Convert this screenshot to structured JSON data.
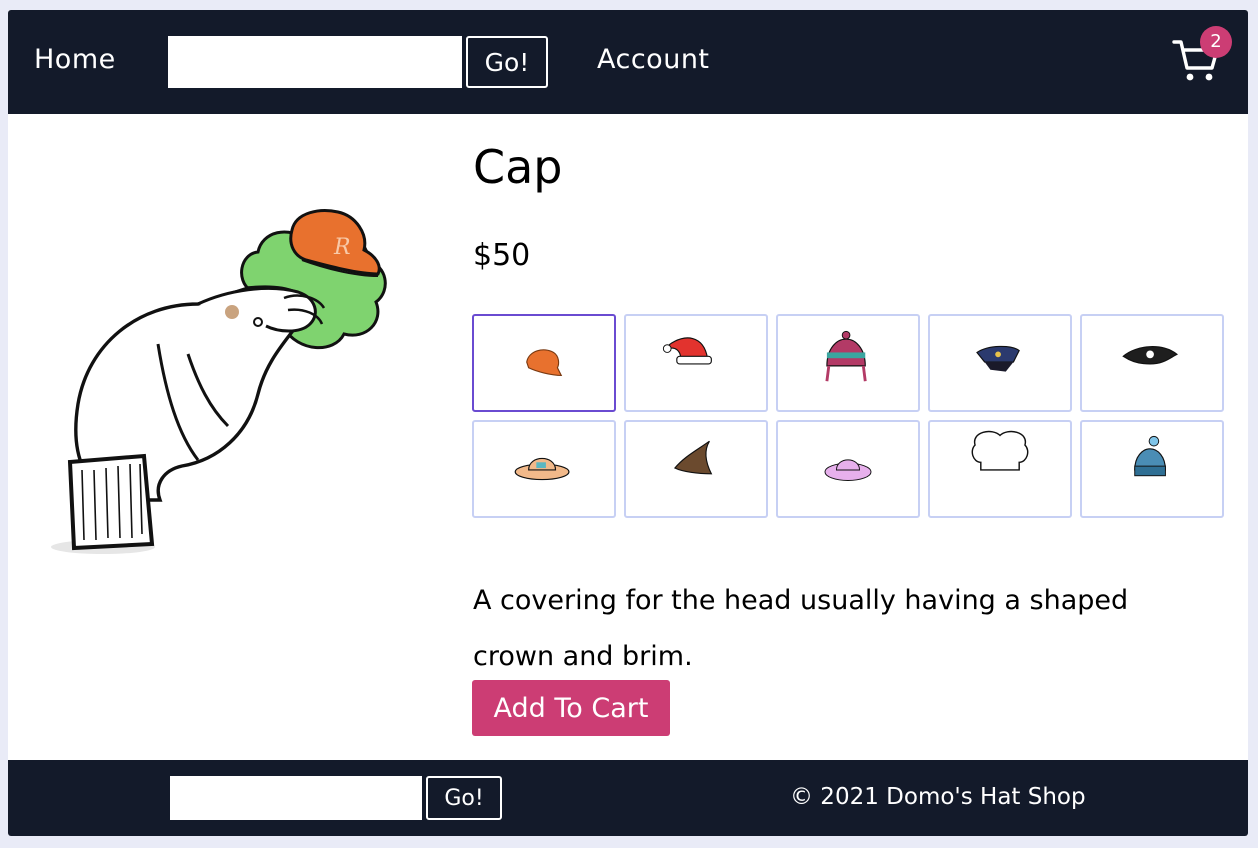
{
  "nav": {
    "home_label": "Home",
    "search_value": "",
    "go_label": "Go!",
    "account_label": "Account",
    "cart_count": "2"
  },
  "product": {
    "title": "Cap",
    "price": "$50",
    "description": "A covering for the head usually having a shaped crown and brim.",
    "add_to_cart_label": "Add To Cart",
    "selected_hat": "cap",
    "hats": [
      "cap",
      "santa-hat",
      "knit-beanie",
      "police-cap",
      "pirate-hat",
      "sun-hat",
      "witch-hat",
      "floppy-hat",
      "chef-hat",
      "pom-beanie"
    ]
  },
  "footer": {
    "search_value": "",
    "go_label": "Go!",
    "copyright": "© 2021 Domo's Hat Shop"
  },
  "colors": {
    "nav_bg": "#131a2a",
    "accent_pink": "#cc3d74",
    "tile_border": "#c7d0f4",
    "selected_border": "#6a4bd1"
  }
}
